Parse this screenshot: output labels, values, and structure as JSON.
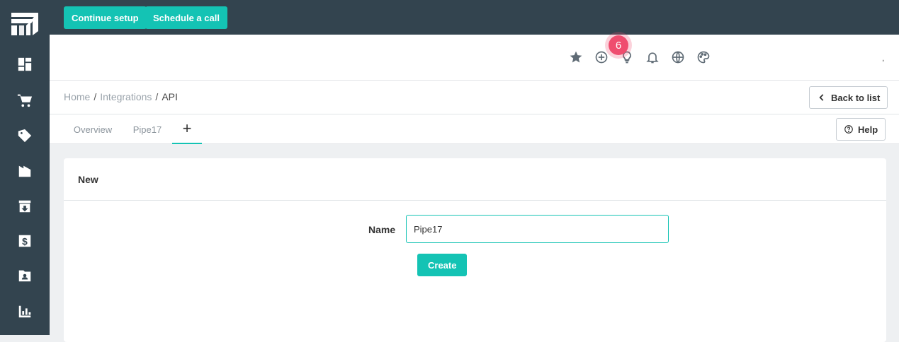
{
  "topbar": {
    "continue_setup": "Continue setup",
    "schedule_call": "Schedule a call"
  },
  "sidebar": {
    "items": [
      "dashboard-icon",
      "cart-icon",
      "tag-icon",
      "warehouse-icon",
      "inbox-icon",
      "dollar-icon",
      "contact-icon",
      "chart-icon"
    ]
  },
  "header": {
    "notification_count": "6",
    "trailing_mark": ","
  },
  "breadcrumb": {
    "home": "Home",
    "sep1": "/",
    "integrations": "Integrations",
    "sep2": "/",
    "current": "API"
  },
  "back_button": "Back to list",
  "help_button": "Help",
  "tabs": [
    {
      "label": "Overview"
    },
    {
      "label": "Pipe17"
    },
    {
      "label": "+"
    }
  ],
  "card": {
    "title": "New",
    "name_label": "Name",
    "name_value": "Pipe17",
    "create_button": "Create"
  },
  "colors": {
    "sidebar_bg": "#33444f",
    "accent": "#14c3b4",
    "badge": "#ef4d6f"
  }
}
